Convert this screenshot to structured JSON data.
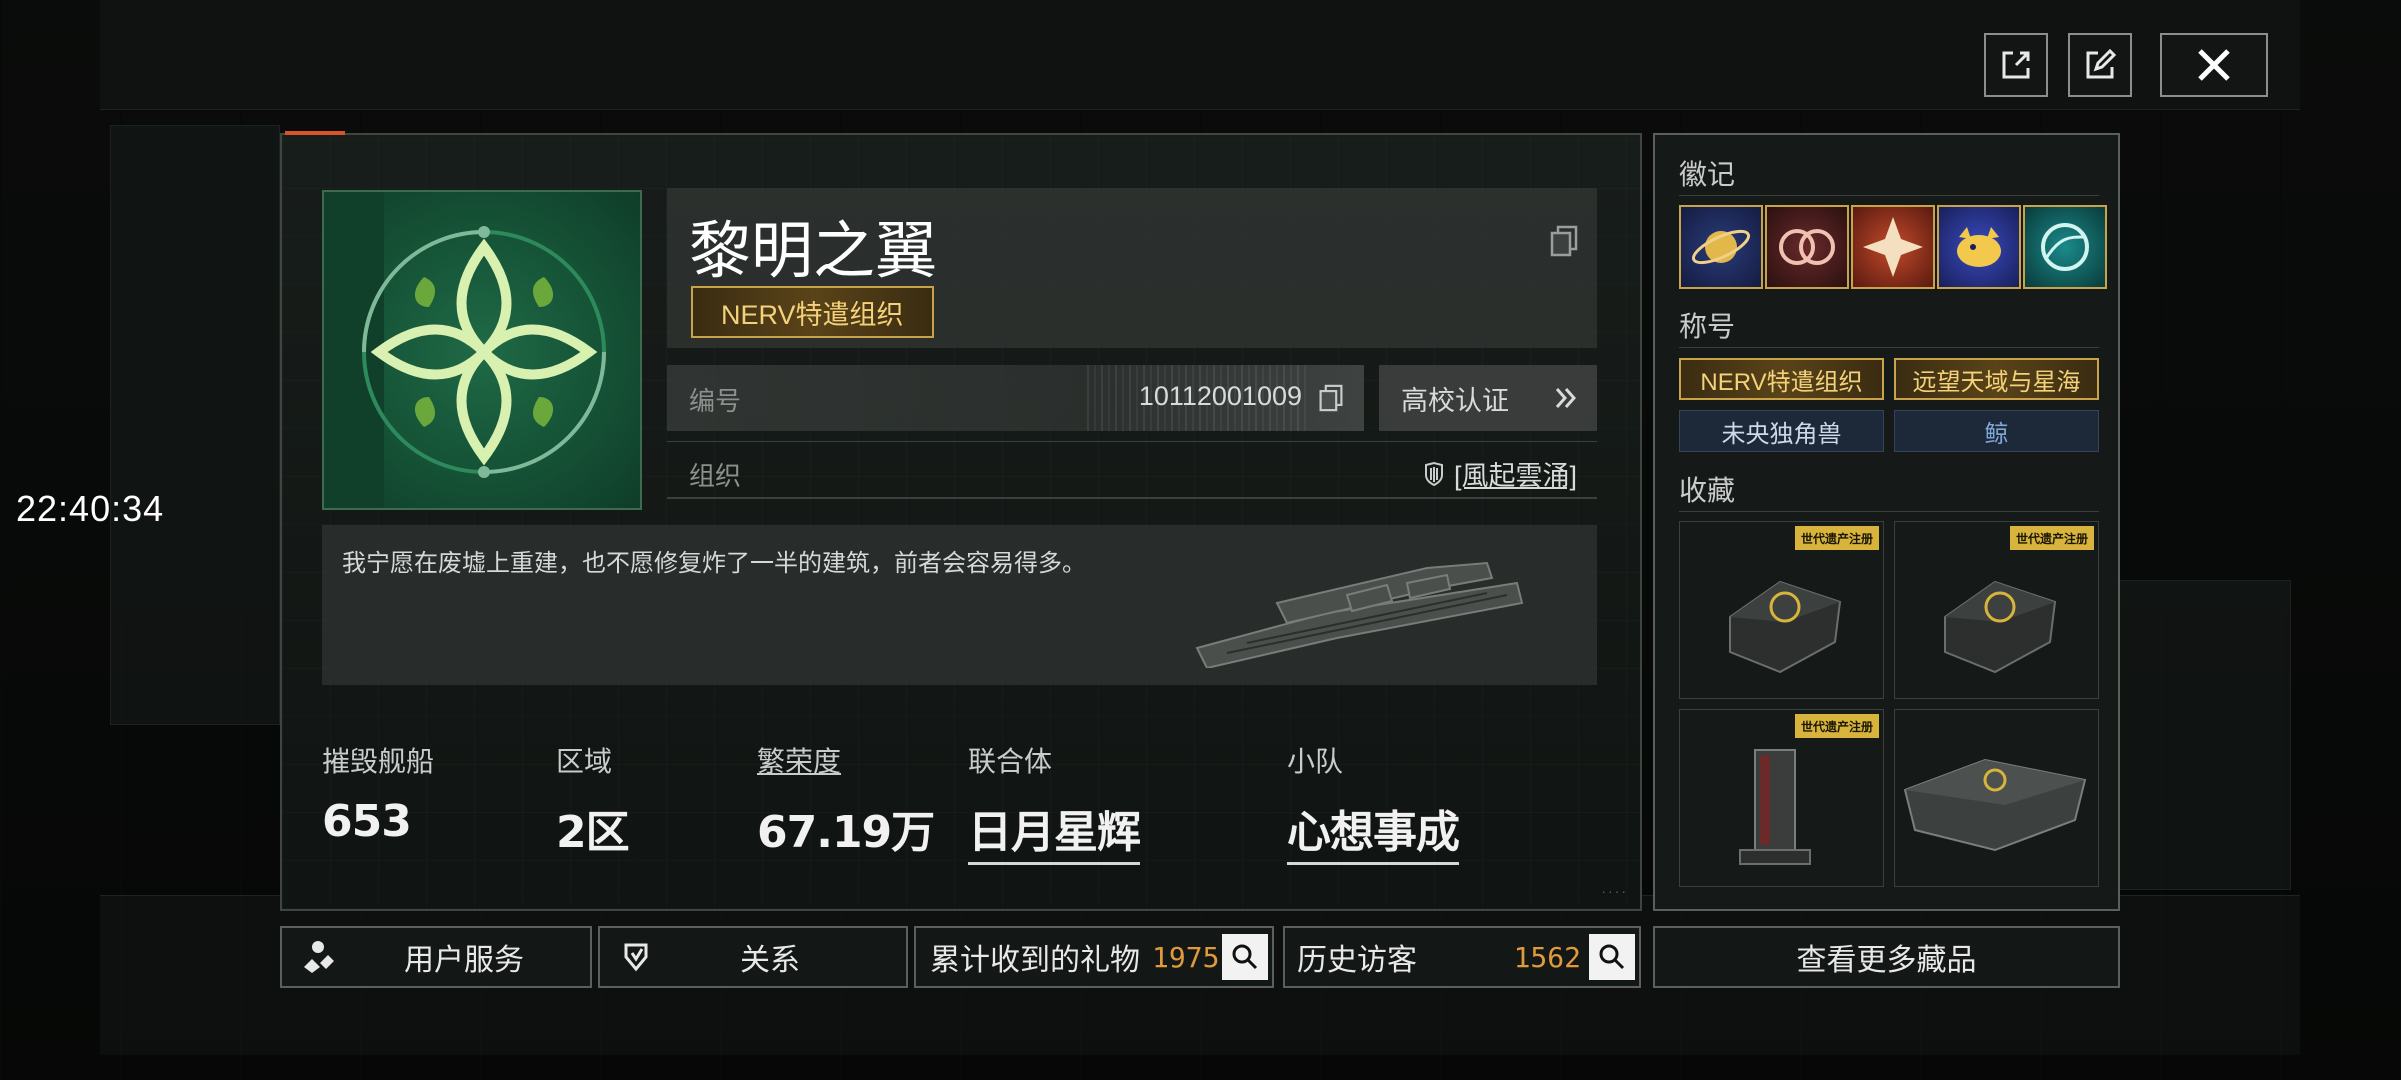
{
  "clock": "22:40:34",
  "top_buttons": [
    {
      "name": "share-icon"
    },
    {
      "name": "edit-icon"
    },
    {
      "name": "close-icon"
    }
  ],
  "profile": {
    "name": "黎明之翼",
    "title_badge": "NERV特遣组织",
    "id_label": "编号",
    "id_value": "10112001009",
    "school_label": "高校认证",
    "org_label": "组织",
    "org_value": "[風起雲涌]",
    "motto": "我宁愿在废墟上重建，也不愿修复炸了一半的建筑，前者会容易得多。"
  },
  "stats": [
    {
      "label": "摧毁舰船",
      "value": "653"
    },
    {
      "label": "区域",
      "value": "2区"
    },
    {
      "label": "繁荣度",
      "value": "67.19万"
    },
    {
      "label": "联合体",
      "value": "日月星辉"
    },
    {
      "label": "小队",
      "value": "心想事成"
    }
  ],
  "side": {
    "badges_header": "徽记",
    "titles_header": "称号",
    "titles": [
      "NERV特遣组织",
      "远望天域与星海",
      "未央独角兽",
      "鲸"
    ],
    "collection_header": "收藏",
    "item_tag": "世代遗产注册"
  },
  "bottom": {
    "user_service": "用户服务",
    "relation": "关系",
    "gifts_label": "累计收到的礼物",
    "gifts_count": "1975",
    "visitors_label": "历史访客",
    "visitors_count": "1562",
    "more_collections": "查看更多藏品"
  },
  "colors": {
    "accent_gold": "#c9a34a",
    "count_orange": "#e09a3c",
    "emblem_green": "#1f6a46"
  }
}
